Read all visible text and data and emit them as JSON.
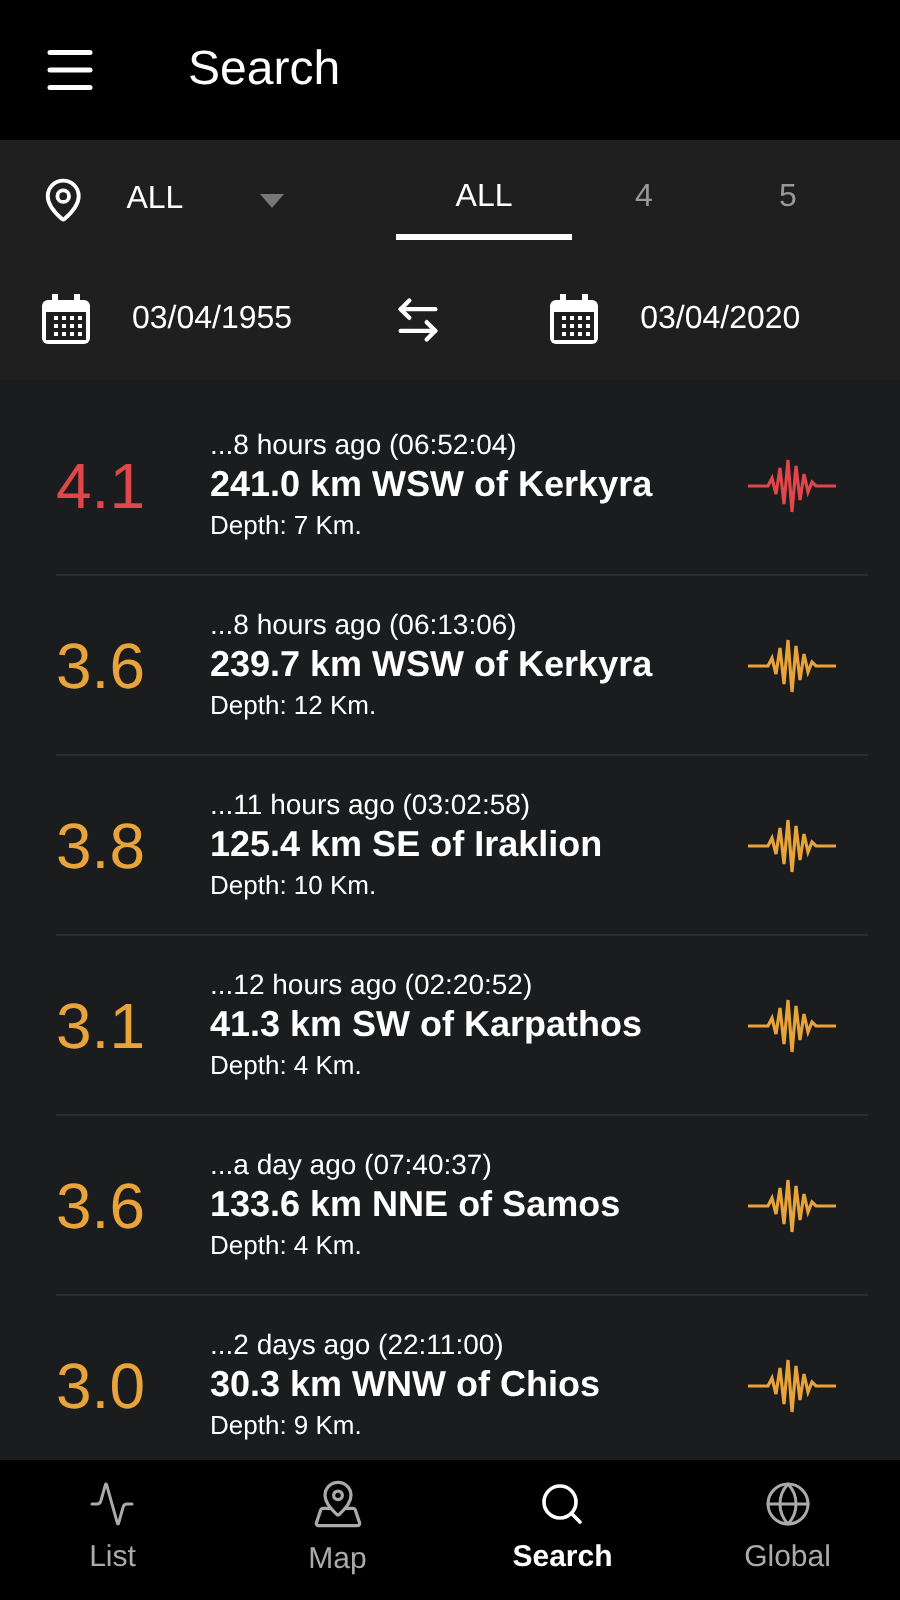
{
  "header": {
    "title": "Search"
  },
  "filter": {
    "region": "ALL",
    "magnitude_tabs": [
      {
        "label": "ALL",
        "selected": true
      },
      {
        "label": "4",
        "selected": false
      },
      {
        "label": "5",
        "selected": false
      }
    ],
    "date_from": "03/04/1955",
    "date_to": "03/04/2020"
  },
  "quakes": [
    {
      "magnitude": "4.1",
      "color": "#e0464a",
      "time": "...8 hours ago (06:52:04)",
      "location": "241.0 km WSW of Kerkyra",
      "depth": "Depth: 7 Km."
    },
    {
      "magnitude": "3.6",
      "color": "#e8a43a",
      "time": "...8 hours ago (06:13:06)",
      "location": "239.7 km WSW of Kerkyra",
      "depth": "Depth: 12 Km."
    },
    {
      "magnitude": "3.8",
      "color": "#e8a43a",
      "time": "...11 hours ago (03:02:58)",
      "location": "125.4 km SE of Iraklion",
      "depth": "Depth: 10 Km."
    },
    {
      "magnitude": "3.1",
      "color": "#e8a43a",
      "time": "...12 hours ago (02:20:52)",
      "location": "41.3 km SW of Karpathos",
      "depth": "Depth: 4 Km."
    },
    {
      "magnitude": "3.6",
      "color": "#e8a43a",
      "time": "...a day ago (07:40:37)",
      "location": "133.6 km NNE of Samos",
      "depth": "Depth: 4 Km."
    },
    {
      "magnitude": "3.0",
      "color": "#e8a43a",
      "time": "...2 days ago (22:11:00)",
      "location": "30.3 km WNW of Chios",
      "depth": "Depth: 9 Km."
    }
  ],
  "bottom_nav": [
    {
      "label": "List",
      "kind": "list",
      "selected": false
    },
    {
      "label": "Map",
      "kind": "map",
      "selected": false
    },
    {
      "label": "Search",
      "kind": "search",
      "selected": true
    },
    {
      "label": "Global",
      "kind": "global",
      "selected": false
    }
  ]
}
